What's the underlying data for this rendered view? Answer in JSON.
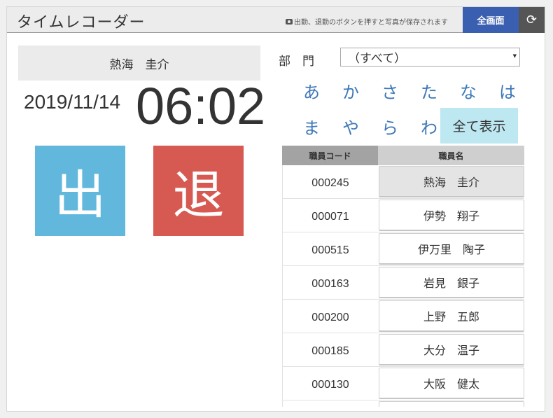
{
  "header": {
    "title": "タイムレコーダー",
    "notice": "出勤、退勤のボタンを押すと写真が保存されます",
    "fullscreen_label": "全画面",
    "camera_icon": "camera-icon",
    "refresh_icon": "refresh-icon"
  },
  "employee": {
    "name": "熱海　圭介"
  },
  "clock": {
    "date": "2019/11/14",
    "time": "06:02"
  },
  "actions": {
    "clock_in_label": "出",
    "clock_out_label": "退",
    "clock_in_color": "#62b8dc",
    "clock_out_color": "#d75a52"
  },
  "filter": {
    "department_label": "部　門",
    "department_value": "（すべて）",
    "kana_row1": [
      "あ",
      "か",
      "さ",
      "た",
      "な",
      "は"
    ],
    "kana_row2": [
      "ま",
      "や",
      "ら",
      "わ"
    ],
    "show_all_label": "全て表示"
  },
  "table": {
    "columns": [
      "職員コード",
      "職員名"
    ],
    "rows": [
      {
        "code": "000245",
        "name": "熱海　圭介"
      },
      {
        "code": "000071",
        "name": "伊勢　翔子"
      },
      {
        "code": "000515",
        "name": "伊万里　陶子"
      },
      {
        "code": "000163",
        "name": "岩見　銀子"
      },
      {
        "code": "000200",
        "name": "上野　五郎"
      },
      {
        "code": "000185",
        "name": "大分　温子"
      },
      {
        "code": "000130",
        "name": "大阪　健太"
      }
    ]
  }
}
